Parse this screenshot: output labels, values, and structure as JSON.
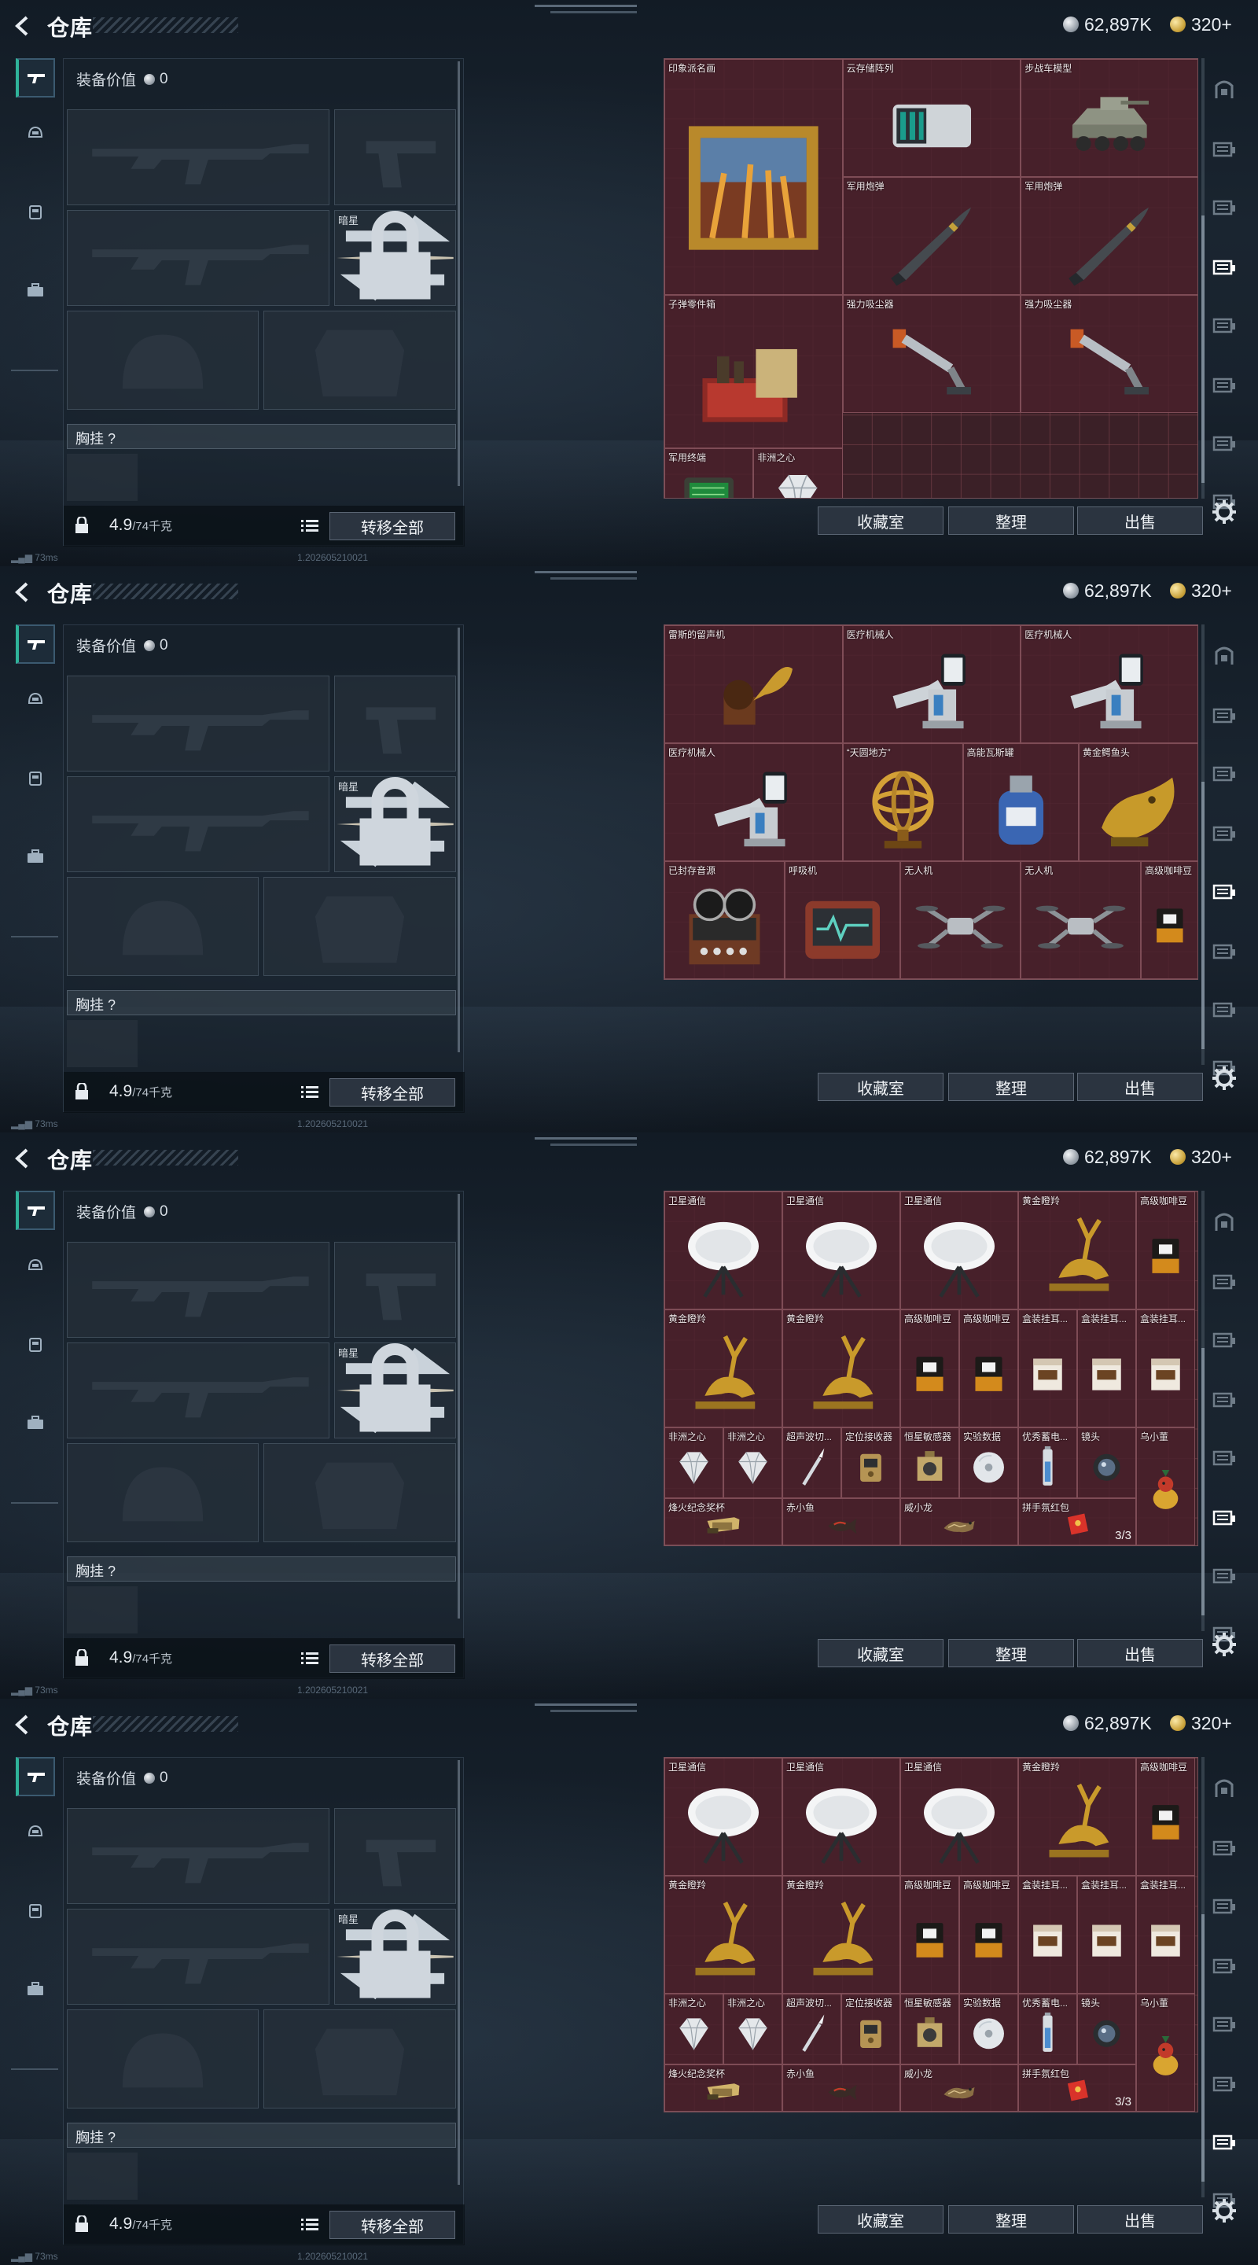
{
  "page_title": "仓库",
  "currency": {
    "silver": "62,897K",
    "gold": "320+"
  },
  "equipment": {
    "value_label": "装备价值",
    "value": "0",
    "melee_slot_label": "暗星",
    "chest_label": "胸挂 ?",
    "weight_current": "4.9",
    "weight_max": "/74千克",
    "transfer_all": "转移全部"
  },
  "actions": {
    "collection": "收藏室",
    "sort": "整理",
    "sell": "出售"
  },
  "status": {
    "ping": "73ms",
    "build": "1.202605210021"
  },
  "nav_icons": [
    "gun-icon",
    "helmet-icon",
    "backpack-icon",
    "case-icon"
  ],
  "rail_icons": [
    "safe-icon",
    "storage-1-icon",
    "storage-2-icon",
    "storage-3-icon",
    "storage-4-icon",
    "storage-5-icon",
    "storage-6-icon",
    "storage-7-icon"
  ],
  "screens": [
    {
      "active_rail": 3,
      "items": [
        {
          "name": "印象派名画",
          "icon": "painting-icon"
        },
        {
          "name": "云存储阵列",
          "icon": "server-icon"
        },
        {
          "name": "步战车模型",
          "icon": "vehicle-icon"
        },
        {
          "name": "军用炮弹",
          "icon": "shell-icon"
        },
        {
          "name": "军用炮弹",
          "icon": "shell-icon"
        },
        {
          "name": "子弹零件箱",
          "icon": "parts-box-icon"
        },
        {
          "name": "强力吸尘器",
          "icon": "vacuum-icon"
        },
        {
          "name": "强力吸尘器",
          "icon": "vacuum-icon"
        },
        {
          "name": "军用终端",
          "icon": "terminal-icon"
        },
        {
          "name": "非洲之心",
          "icon": "diamond-icon"
        }
      ]
    },
    {
      "active_rail": 4,
      "items": [
        {
          "name": "雷斯的留声机",
          "icon": "gramophone-icon"
        },
        {
          "name": "医疗机械人",
          "icon": "medical-robot-icon"
        },
        {
          "name": "医疗机械人",
          "icon": "medical-robot-icon"
        },
        {
          "name": "医疗机械人",
          "icon": "medical-robot-icon"
        },
        {
          "name": "“天圆地方”",
          "icon": "armillary-icon"
        },
        {
          "name": "高能瓦斯罐",
          "icon": "gas-tank-icon"
        },
        {
          "name": "黄金鳄鱼头",
          "icon": "croc-head-icon"
        },
        {
          "name": "已封存音源",
          "icon": "reel-recorder-icon"
        },
        {
          "name": "呼吸机",
          "icon": "ventilator-icon"
        },
        {
          "name": "无人机",
          "icon": "drone-icon"
        },
        {
          "name": "无人机",
          "icon": "drone-icon"
        },
        {
          "name": "高级咖啡豆",
          "icon": "coffee-icon"
        }
      ]
    },
    {
      "active_rail": 5,
      "items": [
        {
          "name": "卫星通信",
          "icon": "satellite-icon"
        },
        {
          "name": "卫星通信",
          "icon": "satellite-icon"
        },
        {
          "name": "卫星通信",
          "icon": "satellite-icon"
        },
        {
          "name": "黄金瞪羚",
          "icon": "gazelle-icon"
        },
        {
          "name": "高级咖啡豆",
          "icon": "coffee-icon"
        },
        {
          "name": "黄金瞪羚",
          "icon": "gazelle-icon"
        },
        {
          "name": "黄金瞪羚",
          "icon": "gazelle-icon"
        },
        {
          "name": "高级咖啡豆",
          "icon": "coffee-icon"
        },
        {
          "name": "高级咖啡豆",
          "icon": "coffee-icon"
        },
        {
          "name": "盒装挂耳...",
          "icon": "coffee-box-icon"
        },
        {
          "name": "盒装挂耳...",
          "icon": "coffee-box-icon"
        },
        {
          "name": "盒装挂耳...",
          "icon": "coffee-box-icon"
        },
        {
          "name": "非洲之心",
          "icon": "diamond-icon"
        },
        {
          "name": "非洲之心",
          "icon": "diamond-icon"
        },
        {
          "name": "超声波切...",
          "icon": "scalpel-icon"
        },
        {
          "name": "定位接收器",
          "icon": "receiver-icon"
        },
        {
          "name": "恒星敏感器",
          "icon": "sensor-icon"
        },
        {
          "name": "实验数据",
          "icon": "data-disc-icon"
        },
        {
          "name": "优秀蓄电...",
          "icon": "battery-icon"
        },
        {
          "name": "镜头",
          "icon": "lens-icon"
        },
        {
          "name": "乌小董",
          "icon": "bird-figure-icon"
        },
        {
          "name": "烽火纪念奖杯",
          "icon": "trophy-icon"
        },
        {
          "name": "赤小鱼",
          "icon": "fish-figure-icon"
        },
        {
          "name": "威小龙",
          "icon": "dragon-figure-icon"
        },
        {
          "name": "拼手氛红包",
          "icon": "red-packet-icon",
          "count": "3/3"
        }
      ]
    },
    {
      "active_rail": 6,
      "items": [
        {
          "name": "卫星通信",
          "icon": "satellite-icon"
        },
        {
          "name": "卫星通信",
          "icon": "satellite-icon"
        },
        {
          "name": "卫星通信",
          "icon": "satellite-icon"
        },
        {
          "name": "黄金瞪羚",
          "icon": "gazelle-icon"
        },
        {
          "name": "高级咖啡豆",
          "icon": "coffee-icon"
        },
        {
          "name": "黄金瞪羚",
          "icon": "gazelle-icon"
        },
        {
          "name": "黄金瞪羚",
          "icon": "gazelle-icon"
        },
        {
          "name": "高级咖啡豆",
          "icon": "coffee-icon"
        },
        {
          "name": "高级咖啡豆",
          "icon": "coffee-icon"
        },
        {
          "name": "盒装挂耳...",
          "icon": "coffee-box-icon"
        },
        {
          "name": "盒装挂耳...",
          "icon": "coffee-box-icon"
        },
        {
          "name": "盒装挂耳...",
          "icon": "coffee-box-icon"
        },
        {
          "name": "非洲之心",
          "icon": "diamond-icon"
        },
        {
          "name": "非洲之心",
          "icon": "diamond-icon"
        },
        {
          "name": "超声波切...",
          "icon": "scalpel-icon"
        },
        {
          "name": "定位接收器",
          "icon": "receiver-icon"
        },
        {
          "name": "恒星敏感器",
          "icon": "sensor-icon"
        },
        {
          "name": "实验数据",
          "icon": "data-disc-icon"
        },
        {
          "name": "优秀蓄电...",
          "icon": "battery-icon"
        },
        {
          "name": "镜头",
          "icon": "lens-icon"
        },
        {
          "name": "乌小董",
          "icon": "bird-figure-icon"
        },
        {
          "name": "烽火纪念奖杯",
          "icon": "trophy-icon"
        },
        {
          "name": "赤小鱼",
          "icon": "fish-figure-icon"
        },
        {
          "name": "威小龙",
          "icon": "dragon-figure-icon"
        },
        {
          "name": "拼手氛红包",
          "icon": "red-packet-icon",
          "count": "3/3"
        }
      ]
    }
  ]
}
